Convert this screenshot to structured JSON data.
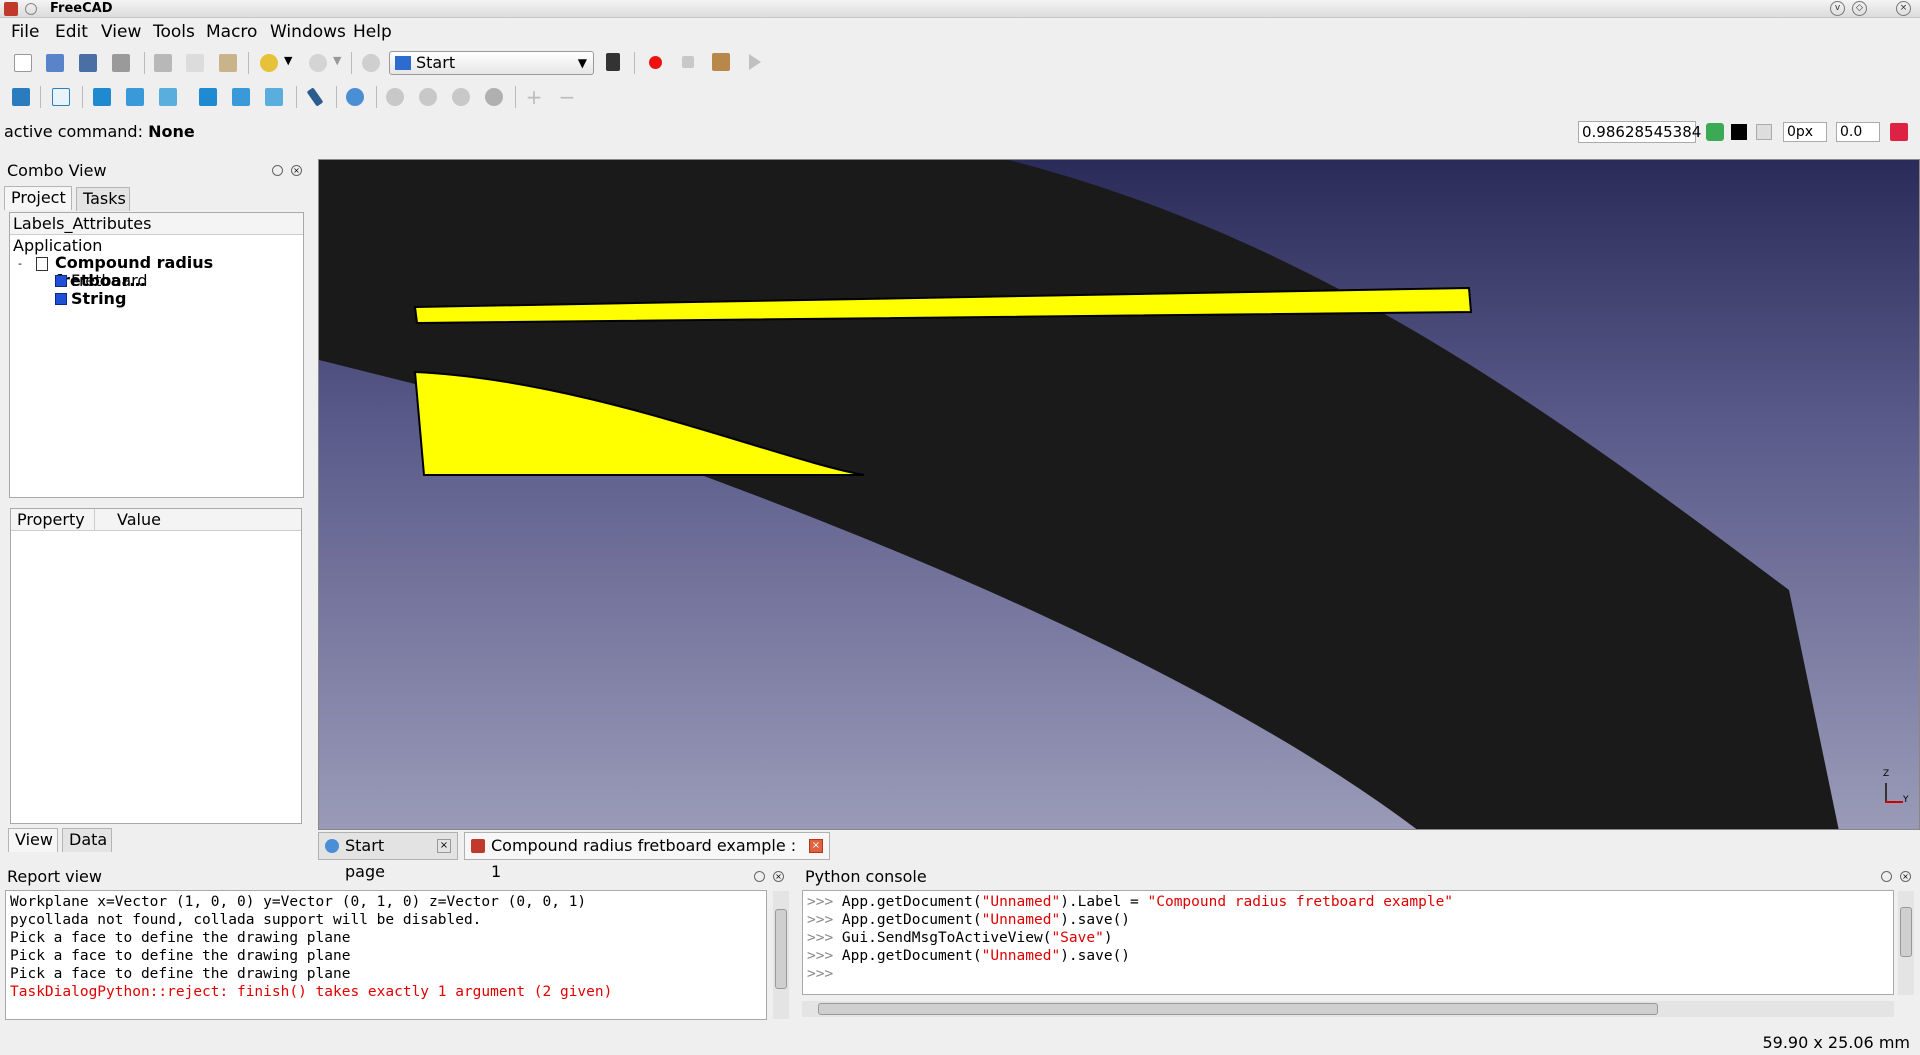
{
  "window": {
    "title": "FreeCAD"
  },
  "menu": [
    "File",
    "Edit",
    "View",
    "Tools",
    "Macro",
    "Windows",
    "Help"
  ],
  "toolbar": {
    "workbench": "Start"
  },
  "command_row": {
    "label": "active command:",
    "value": "None",
    "scale": "0.98628545384",
    "linewidth": "0px",
    "offset": "0.0"
  },
  "combo_view": {
    "title": "Combo View",
    "tabs": [
      "Project",
      "Tasks"
    ],
    "tree_header": "Labels_Attributes",
    "tree": {
      "root": "Application",
      "document": "Compound radius fretboar…",
      "children": [
        "Fretboard",
        "String"
      ]
    },
    "property_headers": [
      "Property",
      "Value"
    ],
    "bottom_tabs": [
      "View",
      "Data"
    ]
  },
  "view_tabs": [
    "Start page",
    "Compound radius fretboard example : 1"
  ],
  "report": {
    "title": "Report view",
    "lines": [
      {
        "text": "Workplane x=Vector (1, 0, 0) y=Vector (0, 1, 0) z=Vector (0, 0, 1)",
        "error": false
      },
      {
        "text": "pycollada not found, collada support will be disabled.",
        "error": false
      },
      {
        "text": "Pick a face to define the drawing plane",
        "error": false
      },
      {
        "text": "Pick a face to define the drawing plane",
        "error": false
      },
      {
        "text": "Pick a face to define the drawing plane",
        "error": false
      },
      {
        "text": "TaskDialogPython::reject: finish() takes exactly 1 argument (2 given)",
        "error": true
      }
    ]
  },
  "console": {
    "title": "Python console",
    "lines": [
      {
        "prompt": ">>> ",
        "code": "App.getDocument(",
        "arg": "\"Unnamed\"",
        "rest": ").Label = ",
        "str": "\"Compound radius fretboard example\""
      },
      {
        "prompt": ">>> ",
        "code": "App.getDocument(",
        "arg": "\"Unnamed\"",
        "rest": ").save()",
        "str": ""
      },
      {
        "prompt": ">>> ",
        "code": "Gui.SendMsgToActiveView(",
        "arg": "\"Save\"",
        "rest": ")",
        "str": ""
      },
      {
        "prompt": ">>> ",
        "code": "App.getDocument(",
        "arg": "\"Unnamed\"",
        "rest": ").save()",
        "str": ""
      },
      {
        "prompt": ">>> ",
        "code": "",
        "arg": "",
        "rest": "",
        "str": ""
      }
    ]
  },
  "axis": {
    "z": "Z",
    "y": "Y"
  },
  "status": {
    "dimensions": "59.90 x 25.06 mm"
  },
  "colors": {
    "shape": "#1a1a1a",
    "face_highlight": "#ffff00",
    "accent_error": "#e00000"
  }
}
